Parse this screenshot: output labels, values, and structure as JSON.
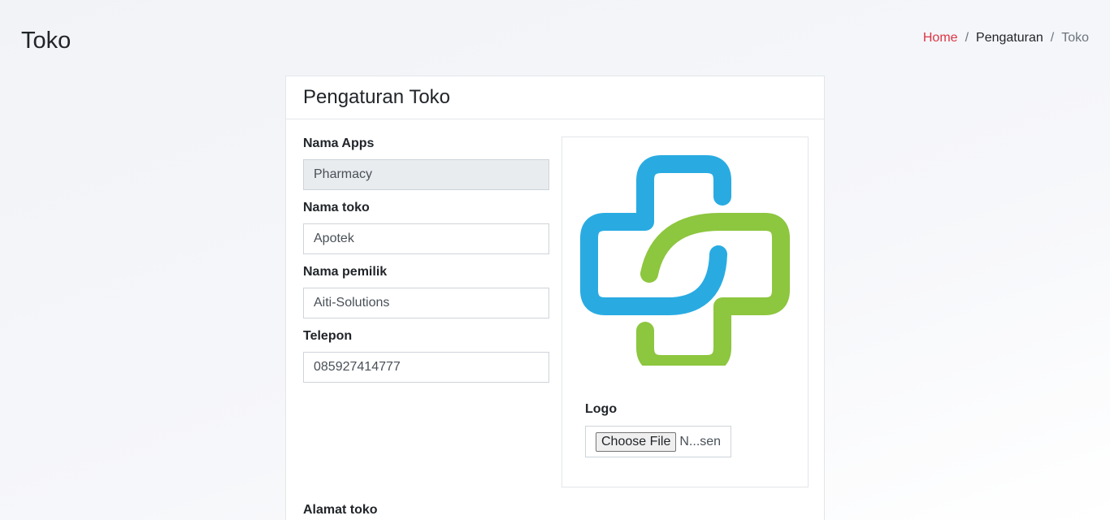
{
  "page": {
    "title": "Toko"
  },
  "breadcrumb": {
    "home": "Home",
    "separator": "/",
    "middle": "Pengaturan",
    "current": "Toko"
  },
  "card": {
    "title": "Pengaturan Toko"
  },
  "form": {
    "nama_apps": {
      "label": "Nama Apps",
      "value": "Pharmacy"
    },
    "nama_toko": {
      "label": "Nama toko",
      "value": "Apotek"
    },
    "nama_pemilik": {
      "label": "Nama pemilik",
      "value": "Aiti-Solutions"
    },
    "telepon": {
      "label": "Telepon",
      "value": "085927414777"
    },
    "alamat_toko": {
      "label": "Alamat toko"
    }
  },
  "logo": {
    "label": "Logo",
    "file_button": "Choose File",
    "file_status": "N...sen",
    "colors": {
      "blue": "#29abe2",
      "green": "#8dc63f"
    }
  },
  "colors": {
    "accent": "#dc3545",
    "readonly_bg": "#e9ecef"
  }
}
